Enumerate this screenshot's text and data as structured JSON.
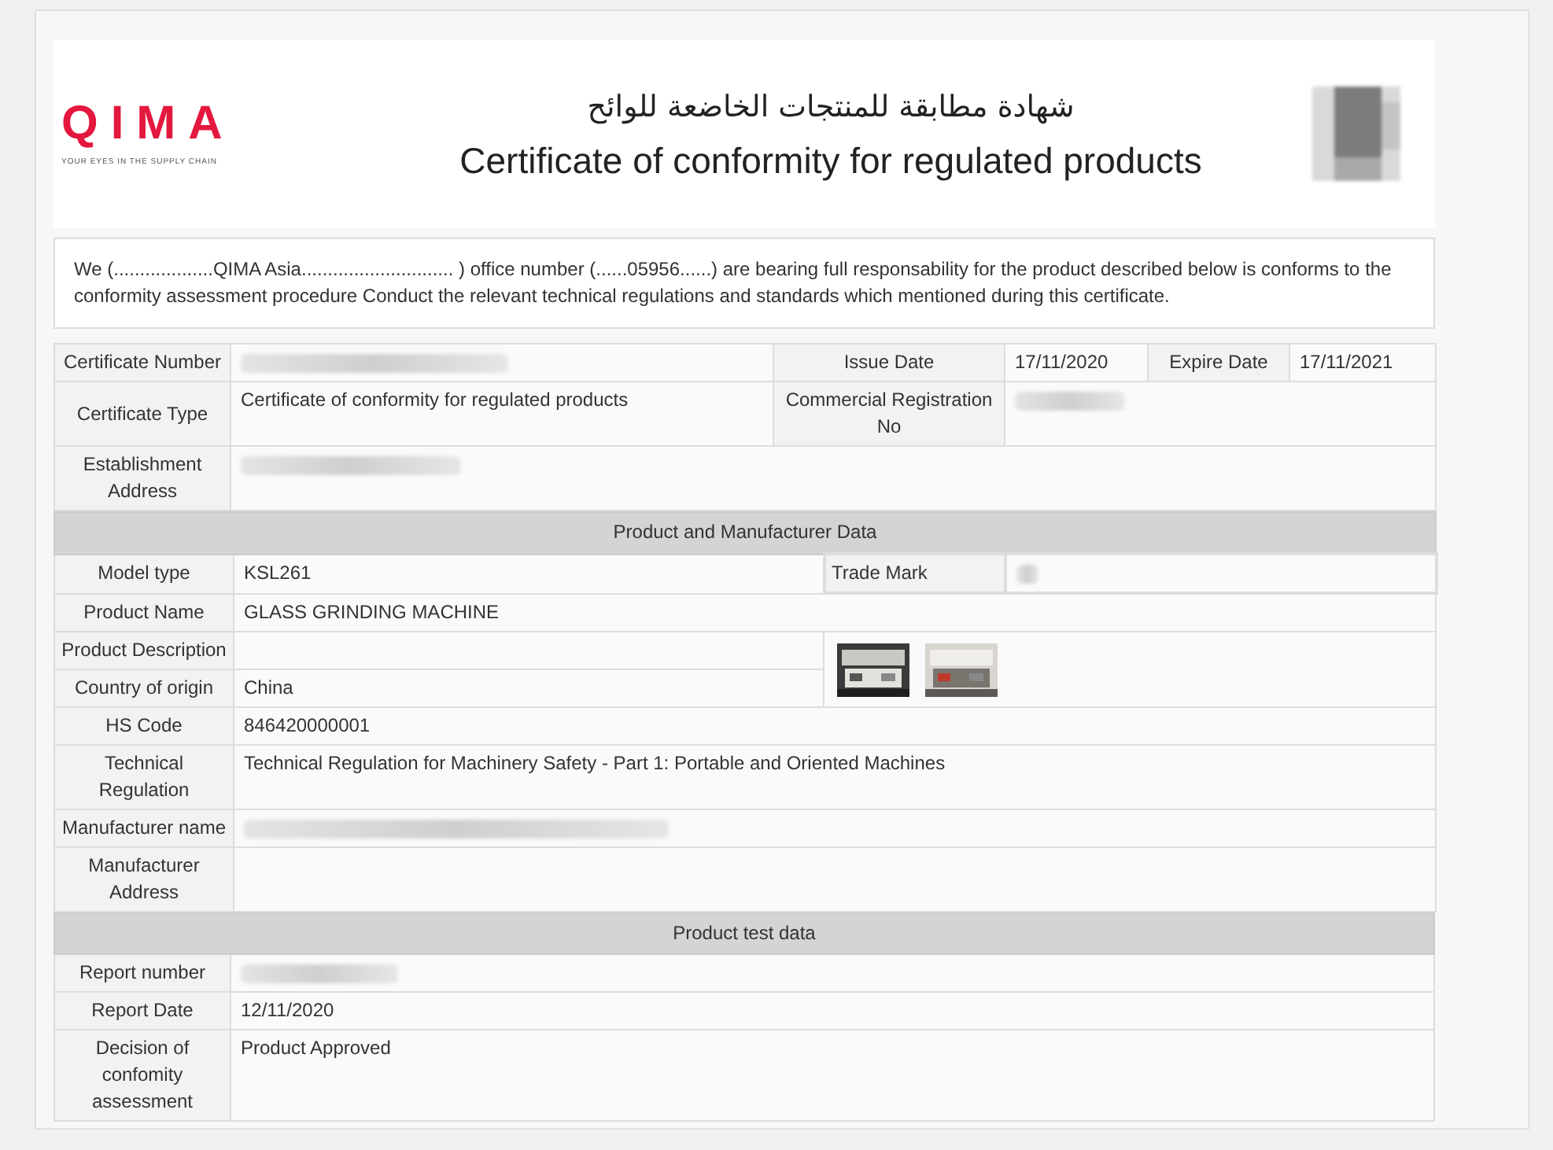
{
  "header": {
    "logo": {
      "wordmark": "QIMA",
      "tagline": "YOUR EYES IN THE SUPPLY CHAIN"
    },
    "title_ar": "شهادة مطابقة للمنتجات الخاضعة للوائح",
    "title_en": "Certificate of conformity for regulated products"
  },
  "statement": "We (...................QIMA Asia............................. ) office number (......05956......) are bearing full responsability for the product described below is conforms to the conformity assessment procedure Conduct the relevant technical regulations and standards which mentioned during this certificate.",
  "certificate": [
    {
      "label": "Certificate Number",
      "redacted": true
    },
    {
      "label": "Issue Date",
      "value": "17/11/2020"
    },
    {
      "label": "Expire Date",
      "value": "17/11/2021"
    },
    {
      "label": "Certificate Type",
      "value": "Certificate of conformity for regulated products"
    },
    {
      "label": "Commercial Registration No",
      "redacted": true
    },
    {
      "label": "Establishment Address",
      "redacted": true
    }
  ],
  "product_section": {
    "title": "Product and Manufacturer Data",
    "fields": [
      {
        "label": "Model type",
        "value": "KSL261"
      },
      {
        "label": "Trade Mark",
        "redacted": true
      },
      {
        "label": "Product Name",
        "value": "GLASS GRINDING MACHINE"
      },
      {
        "label": "Product Description"
      },
      {
        "label": "Country of origin",
        "value": "China"
      },
      {
        "label": "HS Code",
        "value": "846420000001"
      },
      {
        "label": "Technical Regulation",
        "value": "Technical Regulation for Machinery Safety - Part 1: Portable and Oriented Machines"
      },
      {
        "label": "Manufacturer name",
        "redacted": true
      },
      {
        "label": "Manufacturer Address"
      }
    ]
  },
  "test_section": {
    "title": "Product test data",
    "fields": [
      {
        "label": "Report number",
        "redacted": true
      },
      {
        "label": "Report Date",
        "value": "12/11/2020"
      },
      {
        "label": "Decision of confomity assessment",
        "value": "Product Approved"
      }
    ]
  }
}
